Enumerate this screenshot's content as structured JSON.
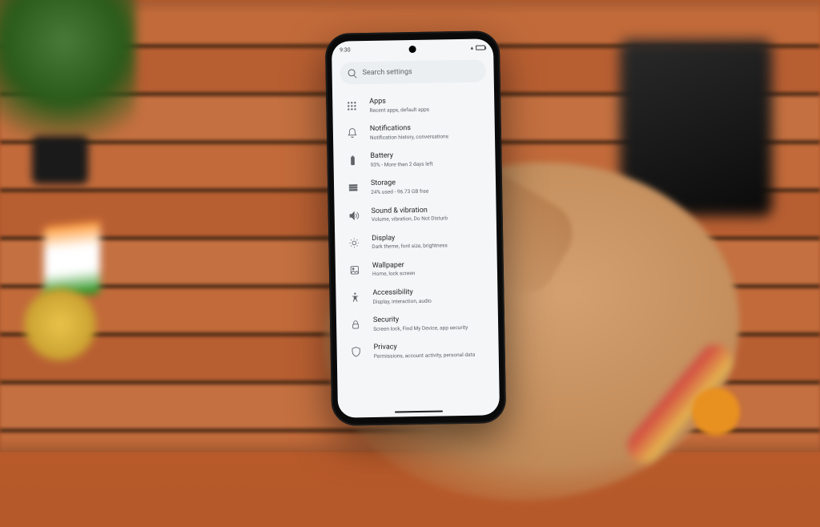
{
  "status": {
    "time": "9:30",
    "battery_icon": "battery"
  },
  "search": {
    "placeholder": "Search settings"
  },
  "settings": [
    {
      "icon": "apps",
      "title": "Apps",
      "subtitle": "Recent apps, default apps"
    },
    {
      "icon": "notifications",
      "title": "Notifications",
      "subtitle": "Notification history, conversations"
    },
    {
      "icon": "battery",
      "title": "Battery",
      "subtitle": "93% - More than 2 days left"
    },
    {
      "icon": "storage",
      "title": "Storage",
      "subtitle": "24% used - 96.73 GB free"
    },
    {
      "icon": "sound",
      "title": "Sound & vibration",
      "subtitle": "Volume, vibration, Do Not Disturb"
    },
    {
      "icon": "display",
      "title": "Display",
      "subtitle": "Dark theme, font size, brightness"
    },
    {
      "icon": "wallpaper",
      "title": "Wallpaper",
      "subtitle": "Home, lock screen"
    },
    {
      "icon": "accessibility",
      "title": "Accessibility",
      "subtitle": "Display, interaction, audio"
    },
    {
      "icon": "security",
      "title": "Security",
      "subtitle": "Screen lock, Find My Device, app security"
    },
    {
      "icon": "privacy",
      "title": "Privacy",
      "subtitle": "Permissions, account activity, personal data"
    }
  ]
}
